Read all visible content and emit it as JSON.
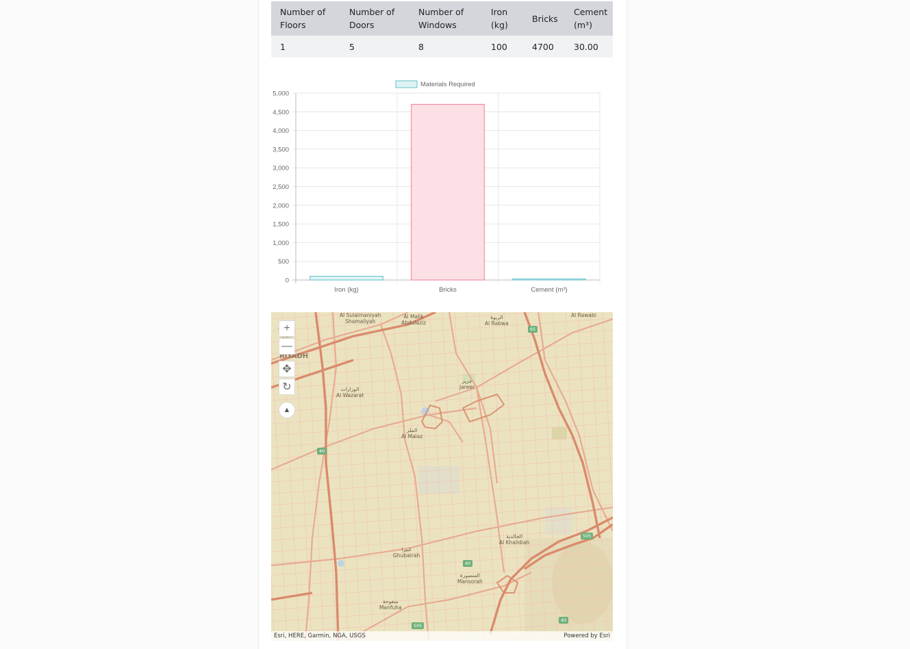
{
  "table": {
    "headers": [
      [
        "Number of",
        "Floors"
      ],
      [
        "Number of",
        "Doors"
      ],
      [
        "Number of",
        "Windows"
      ],
      [
        "Iron",
        "(kg)"
      ],
      [
        "Bricks",
        ""
      ],
      [
        "Cement",
        "(m³)"
      ]
    ],
    "row": [
      "1",
      "5",
      "8",
      "100",
      "4700",
      "30.00"
    ]
  },
  "chart_data": {
    "type": "bar",
    "categories": [
      "Iron (kg)",
      "Bricks",
      "Cement (m³)"
    ],
    "series": [
      {
        "name": "Materials Required",
        "values": [
          100,
          4700,
          30
        ]
      }
    ],
    "ylim": [
      0,
      5000
    ],
    "yticks": [
      "5,000",
      "4,500",
      "4,000",
      "3,500",
      "3,000",
      "2,500",
      "2,000",
      "1,500",
      "1,000",
      "500",
      "0"
    ],
    "colors": {
      "bar_default_fill": "#dff3f4",
      "bar_default_stroke": "#5cc0c6",
      "bar_highlight_fill": "#fde0e6",
      "bar_highlight_stroke": "#f07a9a"
    },
    "legend_position": "top",
    "grid": true
  },
  "map": {
    "controls": [
      {
        "name": "zoom-in-button",
        "glyph": "+"
      },
      {
        "name": "zoom-out-button",
        "glyph": "—"
      },
      {
        "name": "pan-button",
        "glyph": "✥"
      },
      {
        "name": "rotate-button",
        "glyph": "↻"
      },
      {
        "name": "compass-button",
        "glyph": "▲"
      }
    ],
    "labels": [
      {
        "ar": "",
        "en": "Al Sulaimaniyah",
        "en2": "Shamaliyah"
      },
      {
        "ar": "",
        "en": "Al Malik",
        "en2": "Abdulaziz"
      },
      {
        "ar": "الربوة",
        "en": "Al Rabwa"
      },
      {
        "ar": "",
        "en": "Al Rawabi"
      },
      {
        "ar": "العليا",
        "en": "yah Al",
        "en2": "iyah"
      },
      {
        "ar": "",
        "en": "RIYADH"
      },
      {
        "ar": "جرير",
        "en": "Jareer"
      },
      {
        "ar": "الوزارات",
        "en": "Al Wazarat"
      },
      {
        "ar": "الملز",
        "en": "Al Malaz"
      },
      {
        "ar": "الخالدية",
        "en": "Al Khalidiah"
      },
      {
        "ar": "غبيرا",
        "en": "Ghubairah"
      },
      {
        "ar": "المنصورة",
        "en": "Mansorah"
      },
      {
        "ar": "منفوحة",
        "en": "Manfuha"
      }
    ],
    "route_shields": [
      "65",
      "40",
      "40",
      "505",
      "40",
      "505"
    ],
    "attribution": "Esri, HERE, Garmin, NGA, USGS",
    "powered_by": "Powered by Esri"
  }
}
